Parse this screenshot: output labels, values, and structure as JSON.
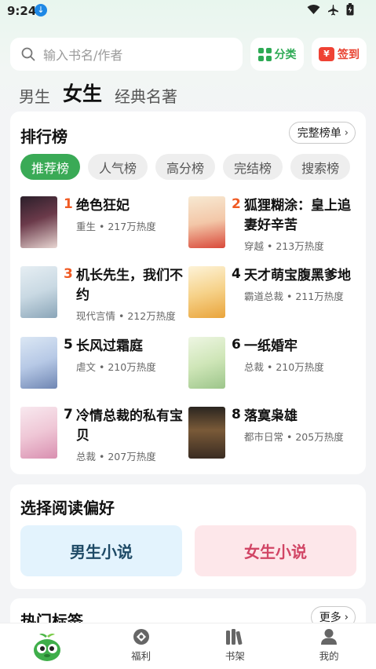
{
  "status_bar": {
    "time": "9:24"
  },
  "search": {
    "placeholder": "输入书名/作者"
  },
  "top_actions": {
    "category_label": "分类",
    "checkin_label": "签到",
    "checkin_icon_text": "¥"
  },
  "gender_tabs": [
    {
      "label": "男生",
      "active": false
    },
    {
      "label": "女生",
      "active": true
    },
    {
      "label": "经典名著",
      "active": false
    }
  ],
  "ranking": {
    "title": "排行榜",
    "full_list_label": "完整榜单",
    "tabs": [
      "推荐榜",
      "人气榜",
      "高分榜",
      "完结榜",
      "搜索榜"
    ],
    "active_tab": "推荐榜",
    "books": [
      {
        "rank": "1",
        "title": "绝色狂妃",
        "genre": "重生",
        "heat": "217万热度"
      },
      {
        "rank": "2",
        "title": "狐狸糊涂：皇上追妻好辛苦",
        "genre": "穿越",
        "heat": "213万热度"
      },
      {
        "rank": "3",
        "title": "机长先生，我们不约",
        "genre": "现代言情",
        "heat": "212万热度"
      },
      {
        "rank": "4",
        "title": "天才萌宝腹黑爹地",
        "genre": "霸道总裁",
        "heat": "211万热度"
      },
      {
        "rank": "5",
        "title": "长风过霜庭",
        "genre": "虐文",
        "heat": "210万热度"
      },
      {
        "rank": "6",
        "title": "一纸婚牢",
        "genre": "总裁",
        "heat": "210万热度"
      },
      {
        "rank": "7",
        "title": "冷情总裁的私有宝贝",
        "genre": "总裁",
        "heat": "207万热度"
      },
      {
        "rank": "8",
        "title": "落寞枭雄",
        "genre": "都市日常",
        "heat": "205万热度"
      }
    ],
    "separator": " • "
  },
  "preference": {
    "title": "选择阅读偏好",
    "male_label": "男生小说",
    "female_label": "女生小说"
  },
  "hot_tags": {
    "title": "热门标签",
    "more_label": "更多"
  },
  "bottom_nav": [
    {
      "label": "",
      "icon": "mascot-icon"
    },
    {
      "label": "福利",
      "icon": "gift-icon"
    },
    {
      "label": "书架",
      "icon": "bookshelf-icon"
    },
    {
      "label": "我的",
      "icon": "profile-icon"
    }
  ],
  "colors": {
    "accent": "#3aaa56",
    "rank_top": "#f05a23",
    "checkin": "#ef4234"
  }
}
